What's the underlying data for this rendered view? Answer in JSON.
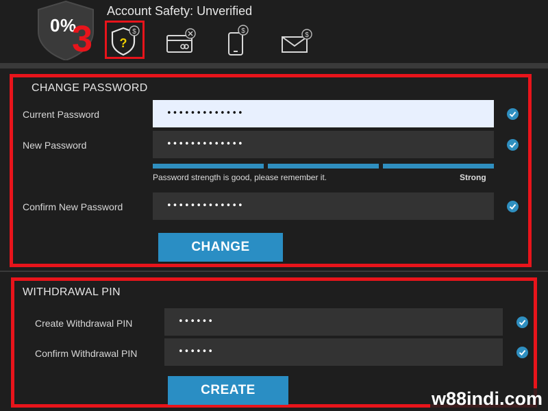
{
  "header": {
    "percent": "0%",
    "step_number": "3",
    "title": "Account Safety: Unverified",
    "icons": [
      "shield-question-icon",
      "card-icon",
      "phone-icon",
      "mail-icon"
    ]
  },
  "change_password": {
    "title": "CHANGE PASSWORD",
    "current_label": "Current Password",
    "current_value": "•••••••••••••",
    "new_label": "New Password",
    "new_value": "•••••••••••••",
    "strength_message": "Password strength is good, please remember it.",
    "strength_level": "Strong",
    "strength_fraction": 1.0,
    "confirm_label": "Confirm New Password",
    "confirm_value": "•••••••••••••",
    "button_label": "CHANGE"
  },
  "withdrawal_pin": {
    "title": "WITHDRAWAL PIN",
    "create_label": "Create Withdrawal PIN",
    "create_value": "••••••",
    "confirm_label": "Confirm Withdrawal PIN",
    "confirm_value": "••••••",
    "button_label": "CREATE"
  },
  "watermark": "w88indi.com",
  "colors": {
    "accent": "#2a8ec4",
    "highlight": "#e8141b",
    "check": "#2f8fc0",
    "background": "#1e1e1e",
    "input": "#333333"
  }
}
